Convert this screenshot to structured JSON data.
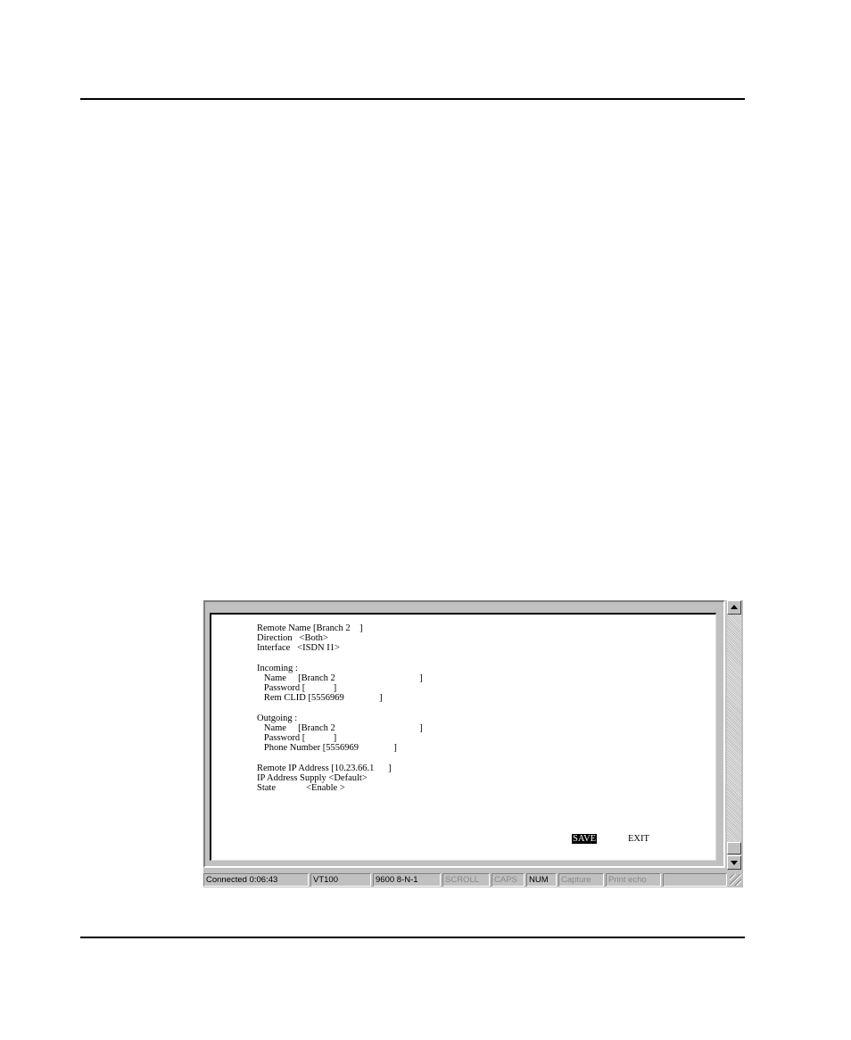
{
  "terminal": {
    "lines": [
      "Remote Name [Branch 2    ]",
      "Direction   <Both>",
      "Interface   <ISDN I1>",
      "",
      "Incoming :",
      "   Name     [Branch 2                                    ]",
      "   Password [            ]",
      "   Rem CLID [5556969               ]",
      "",
      "Outgoing :",
      "   Name     [Branch 2                                    ]",
      "   Password [            ]",
      "   Phone Number [5556969               ]",
      "",
      "Remote IP Address [10.23.66.1      ]",
      "IP Address Supply <Default>",
      "State             <Enable >"
    ],
    "save_label": "SAVE",
    "exit_label": "EXIT"
  },
  "status_bar": {
    "connected": "Connected 0:06:43",
    "emulation": "VT100",
    "port_settings": "9600 8-N-1",
    "scroll": "SCROLL",
    "caps": "CAPS",
    "num": "NUM",
    "capture": "Capture",
    "print_echo": "Print echo"
  }
}
